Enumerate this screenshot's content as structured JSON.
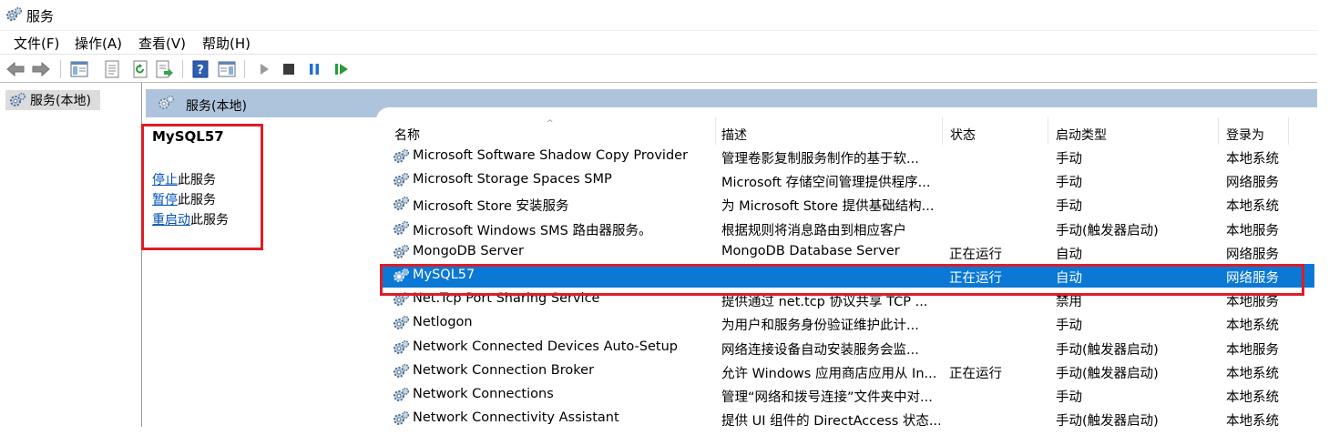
{
  "window": {
    "title": "服务"
  },
  "menu": [
    "文件(F)",
    "操作(A)",
    "查看(V)",
    "帮助(H)"
  ],
  "tree": {
    "root_label": "服务(本地)"
  },
  "content_header": {
    "title": "服务(本地)"
  },
  "action_pane": {
    "service_name": "MySQL57",
    "actions": [
      {
        "link": "停止",
        "suffix": "此服务"
      },
      {
        "link": "暂停",
        "suffix": "此服务"
      },
      {
        "link": "重启动",
        "suffix": "此服务"
      }
    ]
  },
  "table": {
    "columns": [
      "名称",
      "描述",
      "状态",
      "启动类型",
      "登录为"
    ],
    "rows": [
      {
        "name": "Microsoft Software Shadow Copy Provider",
        "desc": "管理卷影复制服务制作的基于软...",
        "status": "",
        "startup": "手动",
        "logon": "本地系统",
        "selected": false
      },
      {
        "name": "Microsoft Storage Spaces SMP",
        "desc": "Microsoft 存储空间管理提供程序...",
        "status": "",
        "startup": "手动",
        "logon": "网络服务",
        "selected": false
      },
      {
        "name": "Microsoft Store 安装服务",
        "desc": "为 Microsoft Store 提供基础结构...",
        "status": "",
        "startup": "手动",
        "logon": "本地系统",
        "selected": false
      },
      {
        "name": "Microsoft Windows SMS 路由器服务。",
        "desc": "根据规则将消息路由到相应客户",
        "status": "",
        "startup": "手动(触发器启动)",
        "logon": "本地服务",
        "selected": false
      },
      {
        "name": "MongoDB Server",
        "desc": "MongoDB Database Server",
        "status": "正在运行",
        "startup": "自动",
        "logon": "网络服务",
        "selected": false
      },
      {
        "name": "MySQL57",
        "desc": "",
        "status": "正在运行",
        "startup": "自动",
        "logon": "网络服务",
        "selected": true
      },
      {
        "name": "Net.Tcp Port Sharing Service",
        "desc": "提供通过 net.tcp 协议共享 TCP ...",
        "status": "",
        "startup": "禁用",
        "logon": "本地服务",
        "selected": false
      },
      {
        "name": "Netlogon",
        "desc": "为用户和服务身份验证维护此计...",
        "status": "",
        "startup": "手动",
        "logon": "本地系统",
        "selected": false
      },
      {
        "name": "Network Connected Devices Auto-Setup",
        "desc": "网络连接设备自动安装服务会监...",
        "status": "",
        "startup": "手动(触发器启动)",
        "logon": "本地服务",
        "selected": false
      },
      {
        "name": "Network Connection Broker",
        "desc": "允许 Windows 应用商店应用从 In...",
        "status": "正在运行",
        "startup": "手动(触发器启动)",
        "logon": "本地系统",
        "selected": false
      },
      {
        "name": "Network Connections",
        "desc": "管理“网络和拨号连接”文件夹中对...",
        "status": "",
        "startup": "手动",
        "logon": "本地系统",
        "selected": false
      },
      {
        "name": "Network Connectivity Assistant",
        "desc": "提供 UI 组件的 DirectAccess 状态...",
        "status": "",
        "startup": "手动(触发器启动)",
        "logon": "本地系统",
        "selected": false
      }
    ]
  },
  "colors": {
    "selection": "#0a78d4",
    "header": "#aec4dc",
    "highlight_box": "#e01c26",
    "link": "#0050b3"
  },
  "icons": [
    "gear-icon",
    "back-arrow-icon",
    "forward-arrow-icon",
    "console-tree-icon",
    "properties-icon",
    "refresh-icon",
    "export-icon",
    "help-icon",
    "panel-icon",
    "play-icon",
    "stop-icon",
    "pause-icon",
    "resume-icon"
  ]
}
